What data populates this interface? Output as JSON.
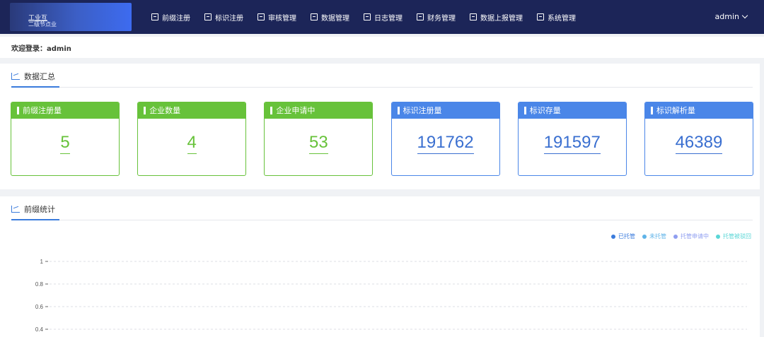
{
  "header": {
    "logo_line1": "工业互",
    "logo_line2": "二级节点业",
    "nav": [
      {
        "label": "前缀注册",
        "icon": "edit-icon"
      },
      {
        "label": "标识注册",
        "icon": "barcode-icon"
      },
      {
        "label": "审核管理",
        "icon": "audit-icon"
      },
      {
        "label": "数据管理",
        "icon": "data-icon"
      },
      {
        "label": "日志管理",
        "icon": "log-icon"
      },
      {
        "label": "财务管理",
        "icon": "finance-icon"
      },
      {
        "label": "数据上报管理",
        "icon": "report-icon"
      },
      {
        "label": "系统管理",
        "icon": "settings-icon"
      }
    ],
    "user": "admin"
  },
  "welcome": "欢迎登录：admin",
  "summary": {
    "title": "数据汇总",
    "cards": [
      {
        "label": "前缀注册量",
        "value": "5",
        "color": "green"
      },
      {
        "label": "企业数量",
        "value": "4",
        "color": "green"
      },
      {
        "label": "企业申请中",
        "value": "53",
        "color": "green"
      },
      {
        "label": "标识注册量",
        "value": "191762",
        "color": "blue"
      },
      {
        "label": "标识存量",
        "value": "191597",
        "color": "blue"
      },
      {
        "label": "标识解析量",
        "value": "46389",
        "color": "blue"
      }
    ]
  },
  "stats": {
    "title": "前缀统计",
    "legend": [
      {
        "label": "已托管",
        "color": "#3a7bdc"
      },
      {
        "label": "未托管",
        "color": "#5fb3e8"
      },
      {
        "label": "托管申请中",
        "color": "#8f9ef0"
      },
      {
        "label": "托管被驳回",
        "color": "#5ad6d6"
      }
    ]
  },
  "chart_data": {
    "type": "bar",
    "categories": [],
    "series": [],
    "y_ticks": [
      "1",
      "0.8",
      "0.6",
      "0.4"
    ],
    "ylim": [
      0,
      1
    ],
    "grid": true,
    "legend_position": "top-right"
  },
  "colors": {
    "nav_bg": "#1c2558",
    "green": "#67c23a",
    "blue": "#4a86e8"
  }
}
